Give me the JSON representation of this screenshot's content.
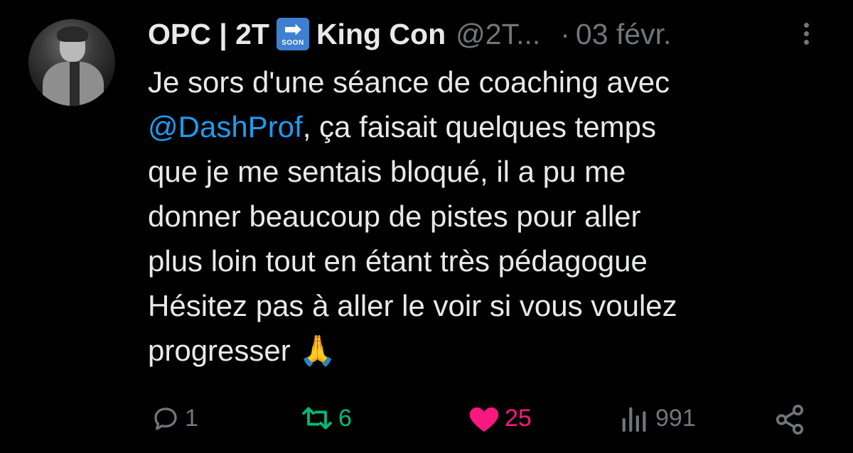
{
  "author": {
    "display_name": "OPC | 2T",
    "badge_text": "SOON",
    "badge_arrow": "➡",
    "display_name_2": "King Con",
    "handle": "@2T...",
    "separator": "·",
    "date": "03 févr."
  },
  "tweet": {
    "line1": "Je sors d'une séance de coaching avec",
    "mention": "@DashProf",
    "line2_rest": ", ça faisait quelques temps",
    "line3": "que je me sentais bloqué, il a pu me",
    "line4": "donner beaucoup de pistes pour aller",
    "line5": "plus loin tout en étant très pédagogue",
    "line6": "Hésitez pas à aller le voir si vous voulez",
    "line7": "progresser",
    "emoji": "🙏"
  },
  "actions": {
    "replies": "1",
    "retweets": "6",
    "likes": "25",
    "views": "991"
  },
  "colors": {
    "mention": "#1d9bf0",
    "retweet": "#00ba7c",
    "like": "#f91880",
    "muted": "#71767b"
  },
  "icons": [
    "reply-icon",
    "retweet-icon",
    "heart-icon",
    "views-icon",
    "share-icon",
    "more-icon"
  ]
}
